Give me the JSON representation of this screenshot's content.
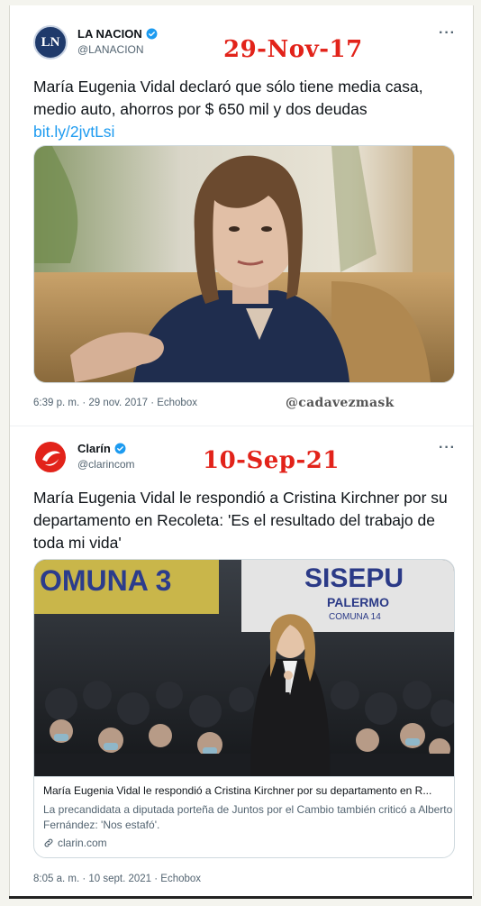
{
  "tweet1": {
    "author_name": "LA NACION",
    "avatar_text": "LN",
    "handle": "@LANACION",
    "overlay_date": "29-Nov-17",
    "text": "María Eugenia Vidal declaró que sólo tiene media casa, medio auto, ahorros por $ 650 mil y dos deudas",
    "link": "bit.ly/2jvtLsi",
    "timestamp": "6:39 p. m. · 29 nov. 2017 · Echobox",
    "watermark": "@cadavezmask"
  },
  "tweet2": {
    "author_name": "Clarín",
    "handle": "@clarincom",
    "overlay_date": "10-Sep-21",
    "text": "María Eugenia Vidal le respondió a Cristina Kirchner por su departamento en Recoleta: 'Es el resultado del trabajo de toda mi vida'",
    "banner_left": "OMUNA 3",
    "banner_right_1": "SISEPU",
    "banner_right_2": "PALERMO",
    "banner_right_3": "COMUNA 14",
    "card": {
      "title": "María Eugenia Vidal le respondió a Cristina Kirchner por su departamento en R...",
      "description": "La precandidata a diputada porteña de Juntos por el Cambio también criticó a Alberto Fernández: 'Nos estafó'.",
      "domain": "clarin.com"
    },
    "timestamp": "8:05 a. m. · 10 sept. 2021 · Echobox"
  },
  "more_label": "···",
  "icons": [
    "verified-badge-icon",
    "more-options-icon",
    "link-icon"
  ],
  "colors": {
    "stamp": "#e2231a",
    "link": "#1d9bf0",
    "verified": "#1d9bf0"
  }
}
